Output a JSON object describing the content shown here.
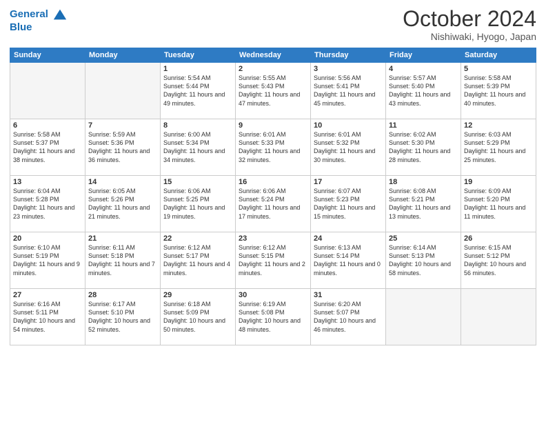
{
  "header": {
    "logo_line1": "General",
    "logo_line2": "Blue",
    "month": "October 2024",
    "location": "Nishiwaki, Hyogo, Japan"
  },
  "days_of_week": [
    "Sunday",
    "Monday",
    "Tuesday",
    "Wednesday",
    "Thursday",
    "Friday",
    "Saturday"
  ],
  "weeks": [
    [
      {
        "day": "",
        "info": ""
      },
      {
        "day": "",
        "info": ""
      },
      {
        "day": "1",
        "info": "Sunrise: 5:54 AM\nSunset: 5:44 PM\nDaylight: 11 hours and 49 minutes."
      },
      {
        "day": "2",
        "info": "Sunrise: 5:55 AM\nSunset: 5:43 PM\nDaylight: 11 hours and 47 minutes."
      },
      {
        "day": "3",
        "info": "Sunrise: 5:56 AM\nSunset: 5:41 PM\nDaylight: 11 hours and 45 minutes."
      },
      {
        "day": "4",
        "info": "Sunrise: 5:57 AM\nSunset: 5:40 PM\nDaylight: 11 hours and 43 minutes."
      },
      {
        "day": "5",
        "info": "Sunrise: 5:58 AM\nSunset: 5:39 PM\nDaylight: 11 hours and 40 minutes."
      }
    ],
    [
      {
        "day": "6",
        "info": "Sunrise: 5:58 AM\nSunset: 5:37 PM\nDaylight: 11 hours and 38 minutes."
      },
      {
        "day": "7",
        "info": "Sunrise: 5:59 AM\nSunset: 5:36 PM\nDaylight: 11 hours and 36 minutes."
      },
      {
        "day": "8",
        "info": "Sunrise: 6:00 AM\nSunset: 5:34 PM\nDaylight: 11 hours and 34 minutes."
      },
      {
        "day": "9",
        "info": "Sunrise: 6:01 AM\nSunset: 5:33 PM\nDaylight: 11 hours and 32 minutes."
      },
      {
        "day": "10",
        "info": "Sunrise: 6:01 AM\nSunset: 5:32 PM\nDaylight: 11 hours and 30 minutes."
      },
      {
        "day": "11",
        "info": "Sunrise: 6:02 AM\nSunset: 5:30 PM\nDaylight: 11 hours and 28 minutes."
      },
      {
        "day": "12",
        "info": "Sunrise: 6:03 AM\nSunset: 5:29 PM\nDaylight: 11 hours and 25 minutes."
      }
    ],
    [
      {
        "day": "13",
        "info": "Sunrise: 6:04 AM\nSunset: 5:28 PM\nDaylight: 11 hours and 23 minutes."
      },
      {
        "day": "14",
        "info": "Sunrise: 6:05 AM\nSunset: 5:26 PM\nDaylight: 11 hours and 21 minutes."
      },
      {
        "day": "15",
        "info": "Sunrise: 6:06 AM\nSunset: 5:25 PM\nDaylight: 11 hours and 19 minutes."
      },
      {
        "day": "16",
        "info": "Sunrise: 6:06 AM\nSunset: 5:24 PM\nDaylight: 11 hours and 17 minutes."
      },
      {
        "day": "17",
        "info": "Sunrise: 6:07 AM\nSunset: 5:23 PM\nDaylight: 11 hours and 15 minutes."
      },
      {
        "day": "18",
        "info": "Sunrise: 6:08 AM\nSunset: 5:21 PM\nDaylight: 11 hours and 13 minutes."
      },
      {
        "day": "19",
        "info": "Sunrise: 6:09 AM\nSunset: 5:20 PM\nDaylight: 11 hours and 11 minutes."
      }
    ],
    [
      {
        "day": "20",
        "info": "Sunrise: 6:10 AM\nSunset: 5:19 PM\nDaylight: 11 hours and 9 minutes."
      },
      {
        "day": "21",
        "info": "Sunrise: 6:11 AM\nSunset: 5:18 PM\nDaylight: 11 hours and 7 minutes."
      },
      {
        "day": "22",
        "info": "Sunrise: 6:12 AM\nSunset: 5:17 PM\nDaylight: 11 hours and 4 minutes."
      },
      {
        "day": "23",
        "info": "Sunrise: 6:12 AM\nSunset: 5:15 PM\nDaylight: 11 hours and 2 minutes."
      },
      {
        "day": "24",
        "info": "Sunrise: 6:13 AM\nSunset: 5:14 PM\nDaylight: 11 hours and 0 minutes."
      },
      {
        "day": "25",
        "info": "Sunrise: 6:14 AM\nSunset: 5:13 PM\nDaylight: 10 hours and 58 minutes."
      },
      {
        "day": "26",
        "info": "Sunrise: 6:15 AM\nSunset: 5:12 PM\nDaylight: 10 hours and 56 minutes."
      }
    ],
    [
      {
        "day": "27",
        "info": "Sunrise: 6:16 AM\nSunset: 5:11 PM\nDaylight: 10 hours and 54 minutes."
      },
      {
        "day": "28",
        "info": "Sunrise: 6:17 AM\nSunset: 5:10 PM\nDaylight: 10 hours and 52 minutes."
      },
      {
        "day": "29",
        "info": "Sunrise: 6:18 AM\nSunset: 5:09 PM\nDaylight: 10 hours and 50 minutes."
      },
      {
        "day": "30",
        "info": "Sunrise: 6:19 AM\nSunset: 5:08 PM\nDaylight: 10 hours and 48 minutes."
      },
      {
        "day": "31",
        "info": "Sunrise: 6:20 AM\nSunset: 5:07 PM\nDaylight: 10 hours and 46 minutes."
      },
      {
        "day": "",
        "info": ""
      },
      {
        "day": "",
        "info": ""
      }
    ]
  ]
}
